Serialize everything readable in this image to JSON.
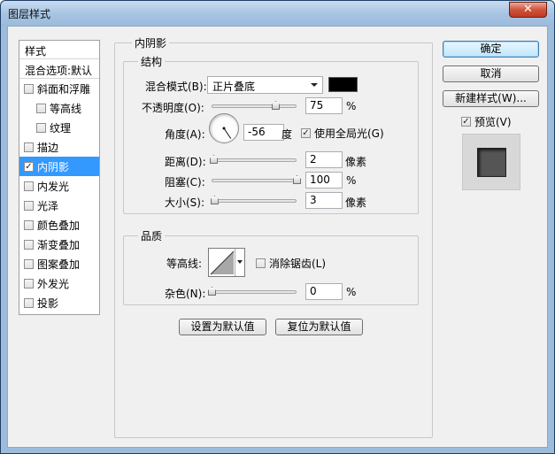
{
  "window": {
    "title": "图层样式",
    "close_glyph": "✕"
  },
  "style_list": {
    "header": "样式",
    "blend_options": "混合选项:默认",
    "items": [
      {
        "label": "斜面和浮雕",
        "checked": false,
        "sub": false
      },
      {
        "label": "等高线",
        "checked": false,
        "sub": true
      },
      {
        "label": "纹理",
        "checked": false,
        "sub": true
      },
      {
        "label": "描边",
        "checked": false,
        "sub": false
      },
      {
        "label": "内阴影",
        "checked": true,
        "sub": false,
        "selected": true
      },
      {
        "label": "内发光",
        "checked": false,
        "sub": false
      },
      {
        "label": "光泽",
        "checked": false,
        "sub": false
      },
      {
        "label": "颜色叠加",
        "checked": false,
        "sub": false
      },
      {
        "label": "渐变叠加",
        "checked": false,
        "sub": false
      },
      {
        "label": "图案叠加",
        "checked": false,
        "sub": false
      },
      {
        "label": "外发光",
        "checked": false,
        "sub": false
      },
      {
        "label": "投影",
        "checked": false,
        "sub": false
      }
    ]
  },
  "panel": {
    "title": "内阴影",
    "structure": {
      "title": "结构",
      "blend_mode_label": "混合模式(B):",
      "blend_mode_value": "正片叠底",
      "shadow_color": "#000000",
      "opacity_label": "不透明度(O):",
      "opacity_value": "75",
      "opacity_unit": "%",
      "opacity_level": 0.75,
      "angle_label": "角度(A):",
      "angle_value": "-56",
      "angle_unit": "度",
      "global_light_label": "使用全局光(G)",
      "global_light_checked": true,
      "distance_label": "距离(D):",
      "distance_value": "2",
      "distance_unit": "像素",
      "distance_level": 0.02,
      "choke_label": "阻塞(C):",
      "choke_value": "100",
      "choke_unit": "%",
      "choke_level": 1.0,
      "size_label": "大小(S):",
      "size_value": "3",
      "size_unit": "像素",
      "size_level": 0.03
    },
    "quality": {
      "title": "品质",
      "contour_label": "等高线:",
      "anti_alias_label": "消除锯齿(L)",
      "anti_alias_checked": false,
      "noise_label": "杂色(N):",
      "noise_value": "0",
      "noise_unit": "%",
      "noise_level": 0.0
    },
    "set_default_button": "设置为默认值",
    "reset_default_button": "复位为默认值"
  },
  "buttons": {
    "ok": "确定",
    "cancel": "取消",
    "new_style": "新建样式(W)...",
    "preview_label": "预览(V)",
    "preview_checked": true
  },
  "colors": {
    "accent": "#3399ff",
    "preview_swatch": "#555555"
  }
}
